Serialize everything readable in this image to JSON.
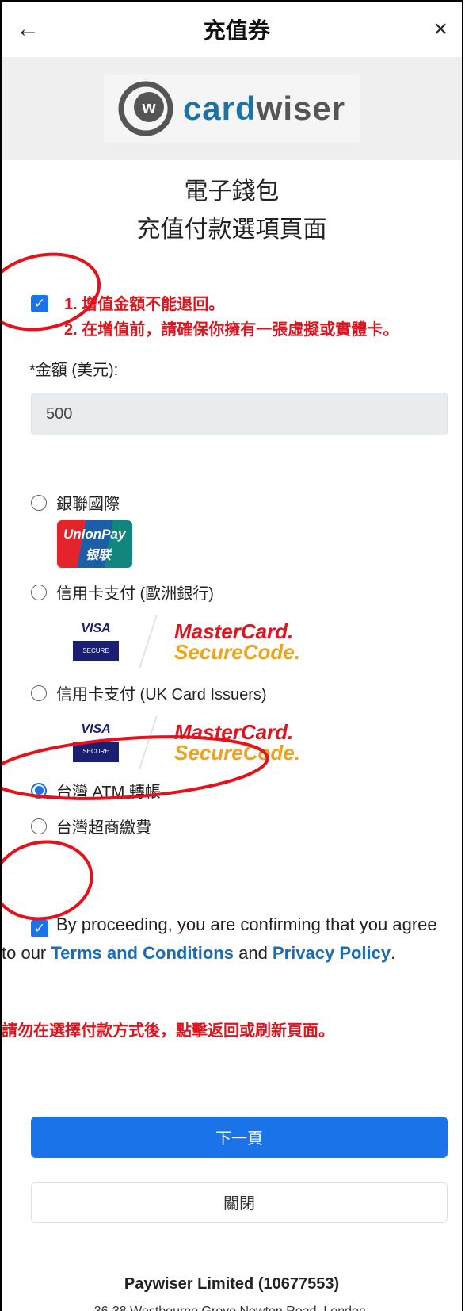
{
  "header": {
    "back_icon": "←",
    "title": "充值券",
    "close_icon": "×"
  },
  "logo": {
    "brand_main": "card",
    "brand_rest": "wiser",
    "mark": "w"
  },
  "heading": {
    "line1": "電子錢包",
    "line2": "充值付款選項頁面"
  },
  "notice": {
    "checked": true,
    "line1": "1. 增值金額不能退回。",
    "line2": "2. 在增值前，請確保你擁有一張虛擬或實體卡。"
  },
  "amount": {
    "label": "*金額 (美元):",
    "value": "500"
  },
  "payment_options": [
    {
      "label": "銀聯國際",
      "selected": false,
      "logo_text1": "UnionPay",
      "logo_text2": "银联"
    },
    {
      "label": "信用卡支付 (歐洲銀行)",
      "selected": false
    },
    {
      "label": "信用卡支付 (UK Card Issuers)",
      "selected": false
    },
    {
      "label": "台灣 ATM 轉帳",
      "selected": true
    },
    {
      "label": "台灣超商繳費",
      "selected": false
    }
  ],
  "card_logos": {
    "visa": "VISA",
    "visa_secure": "SECURE",
    "mc1": "MasterCard.",
    "mc2": "SecureCode."
  },
  "agreement": {
    "checked": true,
    "prefix": "By proceeding, you are confirming that you agree to our ",
    "terms": "Terms and Conditions",
    "and": " and ",
    "privacy": "Privacy Policy",
    "suffix": "."
  },
  "warning": "請勿在選擇付款方式後，點擊返回或刷新頁面。",
  "buttons": {
    "next": "下一頁",
    "close": "關閉"
  },
  "footer": {
    "company": "Paywiser Limited",
    "company_no": "(10677553)",
    "address": "36-38 Westbourne Grove Newton Road, London,"
  },
  "colors": {
    "accent": "#1a73e8",
    "warning": "#e0141e",
    "link": "#1a6bb8",
    "annotation": "#e8101a"
  }
}
